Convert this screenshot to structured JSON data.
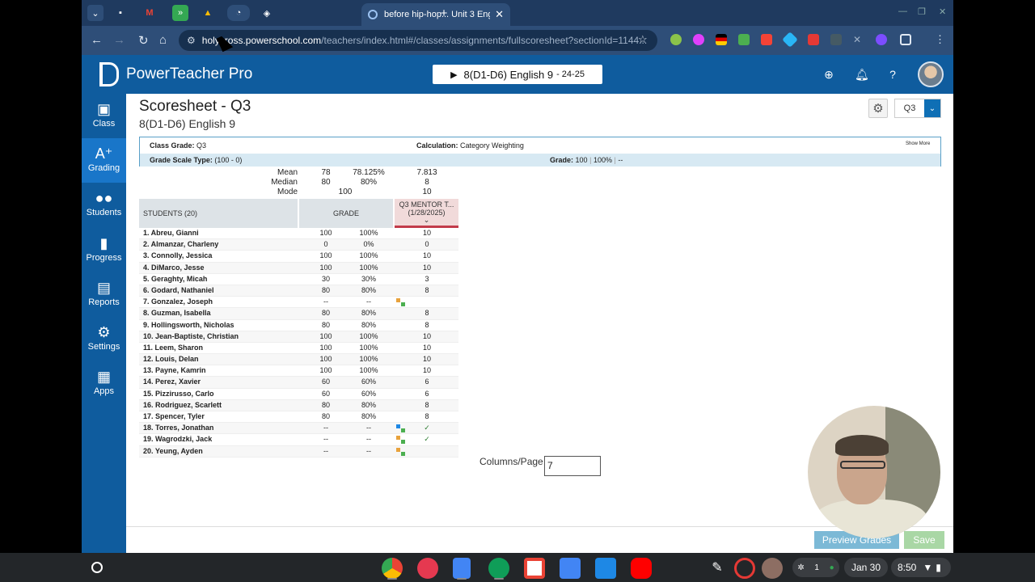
{
  "browser": {
    "active_tab_title": "before hip-hop... Unit 3 English",
    "url_host": "holycross.powerschool.com",
    "url_path": "/teachers/index.html#/classes/assignments/fullscoresheet?sectionId=1144..."
  },
  "app": {
    "brand": "PowerTeacher Pro",
    "class_selector": "8(D1-D6) English 9",
    "class_year": "- 24-25"
  },
  "sidebar": {
    "items": [
      {
        "label": "Class",
        "icon": "class-icon"
      },
      {
        "label": "Grading",
        "icon": "grading-icon"
      },
      {
        "label": "Students",
        "icon": "students-icon"
      },
      {
        "label": "Progress",
        "icon": "progress-icon"
      },
      {
        "label": "Reports",
        "icon": "reports-icon"
      },
      {
        "label": "Settings",
        "icon": "settings-icon"
      },
      {
        "label": "Apps",
        "icon": "apps-icon"
      }
    ]
  },
  "page": {
    "title": "Scoresheet - Q3",
    "subtitle": "8(D1-D6) English 9",
    "term": "Q3"
  },
  "info": {
    "class_grade_label": "Class Grade:",
    "class_grade_value": "Q3",
    "calculation_label": "Calculation:",
    "calculation_value": "Category Weighting",
    "show_more": "Show More",
    "scale_label": "Grade Scale Type:",
    "scale_value": "(100 - 0)",
    "grade_label": "Grade:",
    "grade_value": "100",
    "grade_pct": "100%",
    "grade_letter": "--"
  },
  "stats": {
    "mean_label": "Mean",
    "mean_grade": "78",
    "mean_pct": "78.125%",
    "mean_assign": "7.813",
    "median_label": "Median",
    "median_grade": "80",
    "median_pct": "80%",
    "median_assign": "8",
    "mode_label": "Mode",
    "mode_grade": "100",
    "mode_assign": "10"
  },
  "table": {
    "students_header": "STUDENTS (20)",
    "grade_header": "GRADE",
    "assignment_header": "Q3 MENTOR T...",
    "assignment_date": "(1/28/2025)",
    "rows": [
      {
        "name": "1.  Abreu, Gianni",
        "grade": "100",
        "pct": "100%",
        "score": "10"
      },
      {
        "name": "2.  Almanzar, Charleny",
        "grade": "0",
        "pct": "0%",
        "score": "0"
      },
      {
        "name": "3.  Connolly, Jessica",
        "grade": "100",
        "pct": "100%",
        "score": "10"
      },
      {
        "name": "4.  DiMarco, Jesse",
        "grade": "100",
        "pct": "100%",
        "score": "10"
      },
      {
        "name": "5.  Geraghty, Micah",
        "grade": "30",
        "pct": "30%",
        "score": "3"
      },
      {
        "name": "6.  Godard, Nathaniel",
        "grade": "80",
        "pct": "80%",
        "score": "8"
      },
      {
        "name": "7.  Gonzalez, Joseph",
        "grade": "--",
        "pct": "--",
        "score": ""
      },
      {
        "name": "8.  Guzman, Isabella",
        "grade": "80",
        "pct": "80%",
        "score": "8"
      },
      {
        "name": "9.  Hollingsworth, Nicholas",
        "grade": "80",
        "pct": "80%",
        "score": "8"
      },
      {
        "name": "10.  Jean-Baptiste, Christian",
        "grade": "100",
        "pct": "100%",
        "score": "10"
      },
      {
        "name": "11.  Leem, Sharon",
        "grade": "100",
        "pct": "100%",
        "score": "10"
      },
      {
        "name": "12.  Louis, Delan",
        "grade": "100",
        "pct": "100%",
        "score": "10"
      },
      {
        "name": "13.  Payne, Kamrin",
        "grade": "100",
        "pct": "100%",
        "score": "10"
      },
      {
        "name": "14.  Perez, Xavier",
        "grade": "60",
        "pct": "60%",
        "score": "6"
      },
      {
        "name": "15.  Pizzirusso, Carlo",
        "grade": "60",
        "pct": "60%",
        "score": "6"
      },
      {
        "name": "16.  Rodriguez, Scarlett",
        "grade": "80",
        "pct": "80%",
        "score": "8"
      },
      {
        "name": "17.  Spencer, Tyler",
        "grade": "80",
        "pct": "80%",
        "score": "8"
      },
      {
        "name": "18.  Torres, Jonathan",
        "grade": "--",
        "pct": "--",
        "score": "✓"
      },
      {
        "name": "19.  Wagrodzki, Jack",
        "grade": "--",
        "pct": "--",
        "score": "✓"
      },
      {
        "name": "20.  Yeung, Ayden",
        "grade": "--",
        "pct": "--",
        "score": ""
      }
    ]
  },
  "footer": {
    "columns_label": "Columns/Page",
    "columns_value": "7",
    "preview_button": "Preview Grades",
    "save_button": "Save"
  },
  "shelf": {
    "date": "Jan 30",
    "time": "8:50",
    "notif_count": "1"
  }
}
